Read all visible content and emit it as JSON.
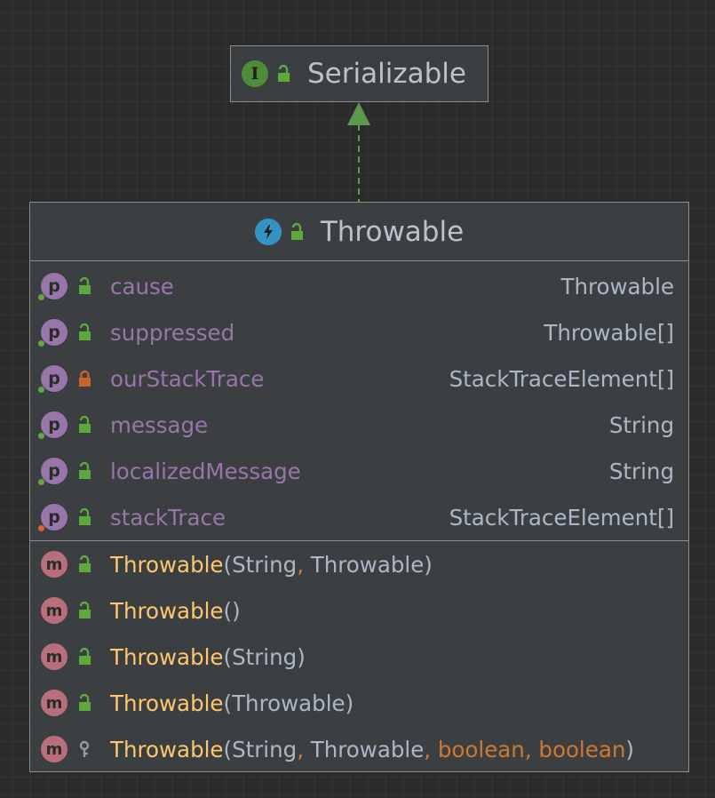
{
  "interface": {
    "badge": "I",
    "name": "Serializable",
    "icon": "lock-open-icon"
  },
  "class": {
    "name": "Throwable",
    "icon": "abstract-class-bolt-icon",
    "fields": [
      {
        "badge": "p",
        "name": "cause",
        "type": "Throwable",
        "access": "public",
        "marker": "green"
      },
      {
        "badge": "p",
        "name": "suppressed",
        "type": "Throwable[]",
        "access": "public",
        "marker": "green"
      },
      {
        "badge": "p",
        "name": "ourStackTrace",
        "type": "StackTraceElement[]",
        "access": "private",
        "marker": "green"
      },
      {
        "badge": "p",
        "name": "message",
        "type": "String",
        "access": "public",
        "marker": "green"
      },
      {
        "badge": "p",
        "name": "localizedMessage",
        "type": "String",
        "access": "public",
        "marker": "green"
      },
      {
        "badge": "p",
        "name": "stackTrace",
        "type": "StackTraceElement[]",
        "access": "public",
        "marker": "orange"
      }
    ],
    "methods": [
      {
        "badge": "m",
        "name": "Throwable",
        "access": "public",
        "open": "(",
        "params": [
          {
            "t": "String",
            "kw": false
          },
          {
            "t": "Throwable",
            "kw": false
          }
        ],
        "close": ")"
      },
      {
        "badge": "m",
        "name": "Throwable",
        "access": "public",
        "open": "(",
        "params": [],
        "close": ")"
      },
      {
        "badge": "m",
        "name": "Throwable",
        "access": "public",
        "open": "(",
        "params": [
          {
            "t": "String",
            "kw": false
          }
        ],
        "close": ")"
      },
      {
        "badge": "m",
        "name": "Throwable",
        "access": "public",
        "open": "(",
        "params": [
          {
            "t": "Throwable",
            "kw": false
          }
        ],
        "close": ")"
      },
      {
        "badge": "m",
        "name": "Throwable",
        "access": "protected",
        "open": "(",
        "params": [
          {
            "t": "String",
            "kw": false
          },
          {
            "t": "Throwable",
            "kw": false
          },
          {
            "t": "boolean",
            "kw": true
          },
          {
            "t": "boolean",
            "kw": true
          }
        ],
        "close": ")"
      }
    ]
  },
  "relation": {
    "type": "implements",
    "from": "Throwable",
    "to": "Serializable",
    "style": "dashed",
    "color": "#5a9a4a"
  },
  "colors": {
    "field_name": "#9876aa",
    "method_name": "#ffc66d",
    "keyword": "#cc7832",
    "text": "#a9b7c6",
    "lock_public": "#5ea83d",
    "lock_private": "#c9622c"
  },
  "separator": ", "
}
